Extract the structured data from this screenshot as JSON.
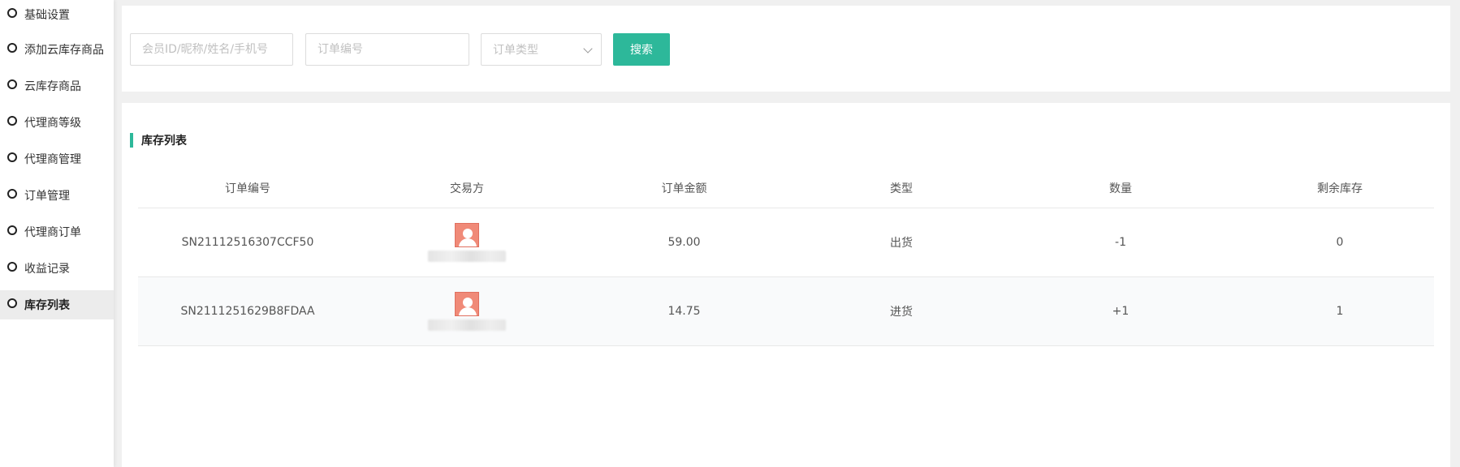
{
  "sidebar": {
    "items": [
      {
        "label": "基础设置"
      },
      {
        "label": "添加云库存商品"
      },
      {
        "label": "云库存商品"
      },
      {
        "label": "代理商等级"
      },
      {
        "label": "代理商管理"
      },
      {
        "label": "订单管理"
      },
      {
        "label": "代理商订单"
      },
      {
        "label": "收益记录"
      },
      {
        "label": "库存列表"
      }
    ],
    "active_index": 8
  },
  "filters": {
    "member_placeholder": "会员ID/昵称/姓名/手机号",
    "order_no_placeholder": "订单编号",
    "order_type_placeholder": "订单类型",
    "search_label": "搜索"
  },
  "list": {
    "title": "库存列表",
    "columns": [
      "订单编号",
      "交易方",
      "订单金额",
      "类型",
      "数量",
      "剩余库存"
    ],
    "rows": [
      {
        "order_no": "SN21112516307CCF50",
        "party_icon": "user-avatar-icon",
        "amount": "59.00",
        "type": "出货",
        "quantity": "-1",
        "remaining": "0"
      },
      {
        "order_no": "SN2111251629B8FDAA",
        "party_icon": "user-avatar-icon",
        "amount": "14.75",
        "type": "进货",
        "quantity": "+1",
        "remaining": "1"
      }
    ]
  },
  "colors": {
    "accent": "#2db89a",
    "avatar": "#f08a78"
  }
}
